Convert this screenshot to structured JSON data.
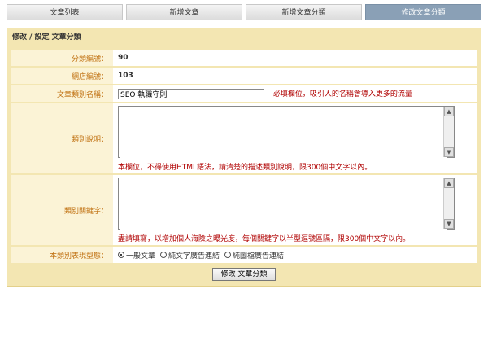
{
  "tabs": [
    {
      "label": "文章列表"
    },
    {
      "label": "新增文章"
    },
    {
      "label": "新增文章分類"
    },
    {
      "label": "修改文章分類"
    }
  ],
  "panel": {
    "title": "修改 / 設定 文章分類",
    "fields": {
      "category_id": {
        "label": "分類編號：",
        "value": "90"
      },
      "site_id": {
        "label": "網店編號：",
        "value": "103"
      },
      "category_name": {
        "label": "文章類別名稱：",
        "value": "SEO 執職守則",
        "note": "必填欄位，吸引人的名稱會導入更多的流量"
      },
      "category_desc": {
        "label": "類別說明：",
        "value": "",
        "note": "本欄位，不得使用HTML語法，請清楚的描述類別說明，限300個中文字以內。"
      },
      "category_keywords": {
        "label": "類別關鍵字：",
        "value": "",
        "note": "盡請填寫，以增加個人海險之曝光度，每個關鍵字以半型逗號區隔，限300個中文字以內。"
      },
      "display_type": {
        "label": "本類別表現型態：",
        "options": [
          "一般文章",
          "純文字廣告連結",
          "純圖檔廣告連結"
        ],
        "selected_index": 0
      }
    },
    "submit_label": "修改 文章分類"
  }
}
